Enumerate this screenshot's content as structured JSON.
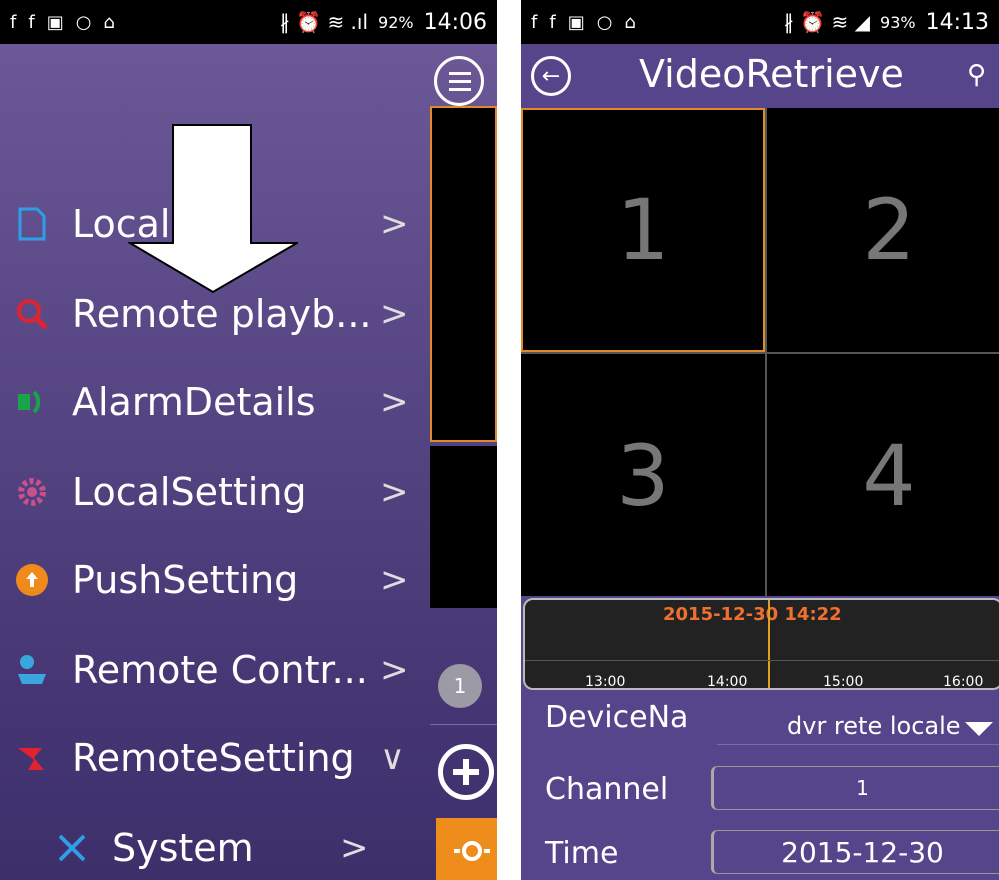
{
  "left_screen": {
    "status": {
      "icons": [
        "f",
        "f",
        "▣",
        "○",
        "⌂"
      ],
      "right_icons": "∦ ⏰ ≋ .ıl",
      "battery": "92%",
      "time": "14:06"
    },
    "menu_items": [
      {
        "label": "Local",
        "icon": "file-icon",
        "icon_color": "#2f9ee8",
        "chevron": ">"
      },
      {
        "label": "Remote playb...",
        "icon": "search-icon",
        "icon_color": "#e0232f",
        "chevron": ">"
      },
      {
        "label": "AlarmDetails",
        "icon": "alarm-icon",
        "icon_color": "#1aa34a",
        "chevron": ">"
      },
      {
        "label": "LocalSetting",
        "icon": "gear-icon",
        "icon_color": "#c8508c",
        "chevron": ">"
      },
      {
        "label": "PushSetting",
        "icon": "push-icon",
        "icon_color": "#ef8a1c",
        "chevron": ">"
      },
      {
        "label": "Remote Contr...",
        "icon": "camera-icon",
        "icon_color": "#3aa6e0",
        "chevron": ">"
      },
      {
        "label": "RemoteSetting",
        "icon": "remote-setting-icon",
        "icon_color": "#e0232f",
        "chevron": "∨"
      },
      {
        "label": "System",
        "icon": "tools-icon",
        "icon_color": "#2f9ee8",
        "chevron": ">"
      }
    ],
    "badge_count": "1"
  },
  "right_screen": {
    "status": {
      "icons": [
        "f",
        "f",
        "▣",
        "○",
        "⌂"
      ],
      "right_icons": "∦ ⏰ ≋ ◢",
      "battery": "93%",
      "time": "14:13"
    },
    "title": "VideoRetrieve",
    "cells": [
      "1",
      "2",
      "3",
      "4"
    ],
    "timeline": {
      "stamp": "2015-12-30 14:22",
      "ticks": [
        "13:00",
        "14:00",
        "15:00",
        "16:00"
      ]
    },
    "device_label": "DeviceNa",
    "device_value": "dvr rete locale",
    "channel_label": "Channel",
    "channel_value": "1",
    "time_label": "Time",
    "time_value": "2015-12-30"
  }
}
